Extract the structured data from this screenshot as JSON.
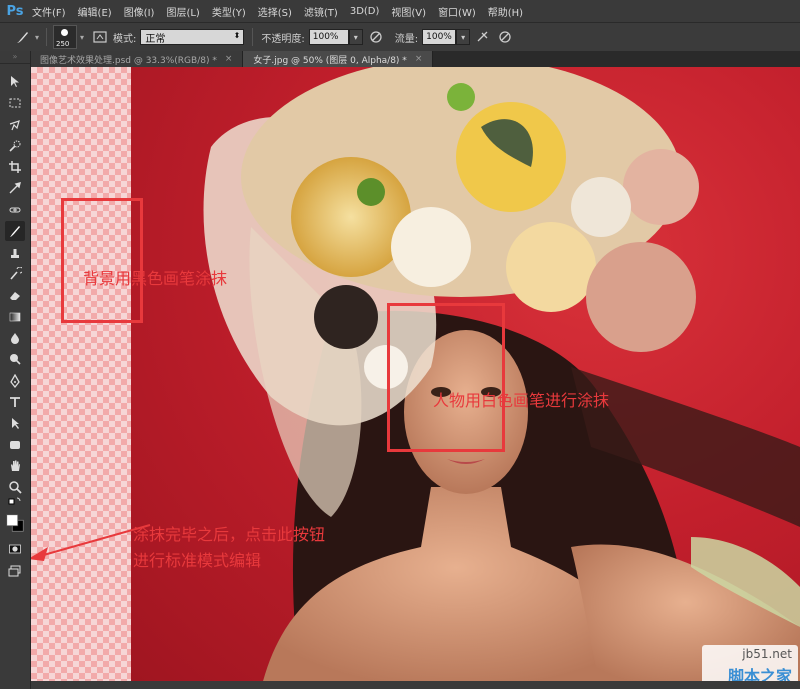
{
  "app": {
    "logo": "Ps"
  },
  "menu": [
    "文件(F)",
    "编辑(E)",
    "图像(I)",
    "图层(L)",
    "类型(Y)",
    "选择(S)",
    "滤镜(T)",
    "3D(D)",
    "视图(V)",
    "窗口(W)",
    "帮助(H)"
  ],
  "options": {
    "brush_size": "250",
    "mode_label": "模式:",
    "mode_value": "正常",
    "opacity_label": "不透明度:",
    "opacity_value": "100%",
    "flow_label": "流量:",
    "flow_value": "100%"
  },
  "tabs": [
    {
      "label": "图像艺术效果处理.psd @ 33.3%(RGB/8) *",
      "active": false
    },
    {
      "label": "女子.jpg @ 50% (图层 0, Alpha/8) *",
      "active": true
    }
  ],
  "annotations": {
    "background_note": "背景用黑色画笔涂抹",
    "person_note": "人物用白色画笔进行涂抹",
    "button_note_line1": "涂抹完毕之后，点击此按钮",
    "button_note_line2": "进行标准模式编辑"
  },
  "annotation_color": "#e8393c",
  "icons": [
    "brush-icon",
    "move-icon",
    "marquee-icon",
    "lasso-icon",
    "quick-select-icon",
    "crop-icon",
    "eyedropper-icon",
    "healing-icon",
    "brush-tool-icon",
    "clone-stamp-icon",
    "history-brush-icon",
    "eraser-icon",
    "gradient-icon",
    "blur-icon",
    "dodge-icon",
    "pen-icon",
    "type-icon",
    "path-select-icon",
    "shape-icon",
    "hand-icon",
    "zoom-icon",
    "quick-mask-icon",
    "screen-mode-icon"
  ],
  "watermark": {
    "url": "jb51.net",
    "name": "脚本之家"
  }
}
